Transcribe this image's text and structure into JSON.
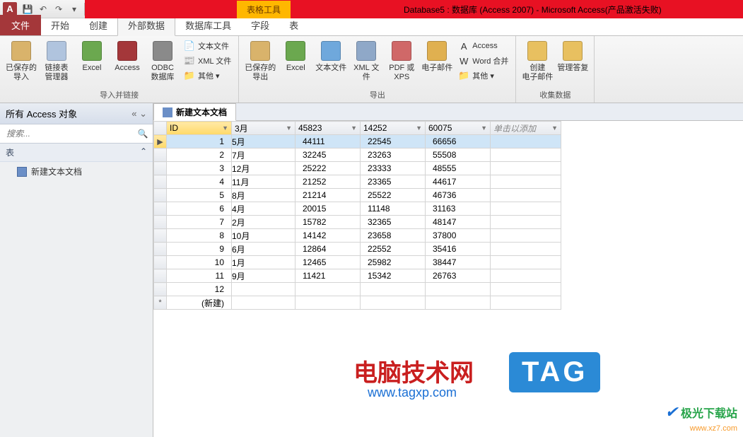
{
  "titlebar": {
    "app_letter": "A",
    "tool_context": "表格工具",
    "title": "Database5 : 数据库 (Access 2007)  -  Microsoft Access(产品激活失败)"
  },
  "tabs": {
    "file": "文件",
    "items": [
      "开始",
      "创建",
      "外部数据",
      "数据库工具",
      "字段",
      "表"
    ],
    "active_index": 2
  },
  "ribbon": {
    "group1": {
      "label": "导入并链接",
      "big": [
        {
          "label": "已保存的\n导入",
          "icon_bg": "#d9b36b"
        },
        {
          "label": "链接表\n管理器",
          "icon_bg": "#b0c4de"
        },
        {
          "label": "Excel",
          "icon_bg": "#6ba84f"
        },
        {
          "label": "Access",
          "icon_bg": "#a4373a"
        },
        {
          "label": "ODBC 数据库",
          "icon_bg": "#8a8a8a"
        }
      ],
      "small": [
        {
          "label": "文本文件",
          "icon": "📄"
        },
        {
          "label": "XML 文件",
          "icon": "📰"
        },
        {
          "label": "其他 ▾",
          "icon": "📁"
        }
      ]
    },
    "group2": {
      "label": "导出",
      "big": [
        {
          "label": "已保存的\n导出",
          "icon_bg": "#d9b36b"
        },
        {
          "label": "Excel",
          "icon_bg": "#6ba84f"
        },
        {
          "label": "文本文件",
          "icon_bg": "#6fa8dc"
        },
        {
          "label": "XML 文件",
          "icon_bg": "#8fa8c8"
        },
        {
          "label": "PDF 或 XPS",
          "icon_bg": "#d06868"
        },
        {
          "label": "电子邮件",
          "icon_bg": "#e0b050"
        }
      ],
      "small": [
        {
          "label": "Access",
          "icon": "A"
        },
        {
          "label": "Word 合并",
          "icon": "W"
        },
        {
          "label": "其他 ▾",
          "icon": "📁"
        }
      ]
    },
    "group3": {
      "label": "收集数据",
      "big": [
        {
          "label": "创建\n电子邮件",
          "icon_bg": "#e8c060"
        },
        {
          "label": "管理答复",
          "icon_bg": "#e8c060"
        }
      ]
    }
  },
  "nav": {
    "header": "所有 Access 对象",
    "search_placeholder": "搜索...",
    "group": "表",
    "item": "新建文本文档"
  },
  "datasheet": {
    "tab": "新建文本文档",
    "columns": [
      "ID",
      "3月",
      "45823",
      "14252",
      "60075"
    ],
    "add_column": "单击以添加",
    "new_row": "(新建)",
    "new_marker": "*",
    "rows": [
      {
        "id": 1,
        "c1": "5月",
        "c2": 44111,
        "c3": 22545,
        "c4": 66656,
        "sel": true
      },
      {
        "id": 2,
        "c1": "7月",
        "c2": 32245,
        "c3": 23263,
        "c4": 55508
      },
      {
        "id": 3,
        "c1": "12月",
        "c2": 25222,
        "c3": 23333,
        "c4": 48555
      },
      {
        "id": 4,
        "c1": "11月",
        "c2": 21252,
        "c3": 23365,
        "c4": 44617
      },
      {
        "id": 5,
        "c1": "8月",
        "c2": 21214,
        "c3": 25522,
        "c4": 46736
      },
      {
        "id": 6,
        "c1": "4月",
        "c2": 20015,
        "c3": 11148,
        "c4": 31163
      },
      {
        "id": 7,
        "c1": "2月",
        "c2": 15782,
        "c3": 32365,
        "c4": 48147
      },
      {
        "id": 8,
        "c1": "10月",
        "c2": 14142,
        "c3": 23658,
        "c4": 37800
      },
      {
        "id": 9,
        "c1": "6月",
        "c2": 12864,
        "c3": 22552,
        "c4": 35416
      },
      {
        "id": 10,
        "c1": "1月",
        "c2": 12465,
        "c3": 25982,
        "c4": 38447
      },
      {
        "id": 11,
        "c1": "9月",
        "c2": 11421,
        "c3": 15342,
        "c4": 26763
      },
      {
        "id": 12,
        "c1": "",
        "c2": "",
        "c3": "",
        "c4": ""
      }
    ]
  },
  "watermark": {
    "text1": "电脑技术网",
    "url1": "www.tagxp.com",
    "tag": "TAG",
    "text2": "极光下载站",
    "url2": "www.xz7.com"
  }
}
